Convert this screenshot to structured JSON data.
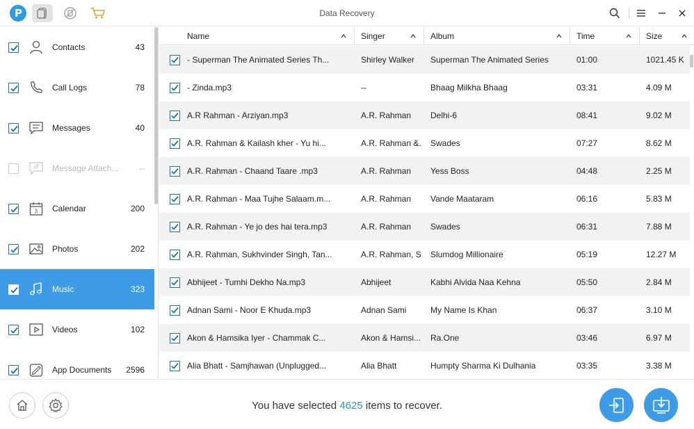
{
  "window": {
    "title": "Data Recovery",
    "logo_letter": "P"
  },
  "sidebar": {
    "items": [
      {
        "label": "Contacts",
        "count": "43",
        "icon": "person-icon",
        "checked": true
      },
      {
        "label": "Call Logs",
        "count": "78",
        "icon": "phone-icon",
        "checked": true
      },
      {
        "label": "Messages",
        "count": "40",
        "icon": "message-icon",
        "checked": true
      },
      {
        "label": "Message Attach...",
        "count": "--",
        "icon": "attachment-icon",
        "checked": false
      },
      {
        "label": "Calendar",
        "count": "200",
        "icon": "calendar-icon",
        "checked": true
      },
      {
        "label": "Photos",
        "count": "202",
        "icon": "photo-icon",
        "checked": true
      },
      {
        "label": "Music",
        "count": "323",
        "icon": "music-icon",
        "checked": true
      },
      {
        "label": "Videos",
        "count": "102",
        "icon": "video-icon",
        "checked": true
      },
      {
        "label": "App Documents",
        "count": "2596",
        "icon": "document-icon",
        "checked": true
      }
    ],
    "calendar_day": "3"
  },
  "table": {
    "columns": [
      "Name",
      "Singer",
      "Album",
      "Time",
      "Size"
    ],
    "rows": [
      {
        "name": "- Superman The Animated Series Th...",
        "singer": "Shirley Walker",
        "album": "Superman The Animated Series",
        "time": "01:00",
        "size": "1021.45 K"
      },
      {
        "name": "- Zinda.mp3",
        "singer": "--",
        "album": "Bhaag Milkha Bhaag",
        "time": "03:31",
        "size": "4.09 M"
      },
      {
        "name": "A.R Rahman - Arziyan.mp3",
        "singer": "A.R. Rahman",
        "album": "Delhi-6",
        "time": "08:41",
        "size": "9.02 M"
      },
      {
        "name": "A.R. Rahman & Kailash kher - Yu hi...",
        "singer": "A.R. Rahman &...",
        "album": "Swades",
        "time": "07:27",
        "size": "8.62 M"
      },
      {
        "name": "A.R. Rahman - Chaand Taare .mp3",
        "singer": "A.R. Rahman",
        "album": "Yess Boss",
        "time": "04:48",
        "size": "2.25 M"
      },
      {
        "name": "A.R. Rahman - Maa Tujhe Salaam.m...",
        "singer": "A.R. Rahman",
        "album": "Vande Maataram",
        "time": "06:16",
        "size": "5.83 M"
      },
      {
        "name": "A.R. Rahman - Ye jo des hai tera.mp3",
        "singer": "A.R. Rahman",
        "album": "Swades",
        "time": "06:31",
        "size": "7.88 M"
      },
      {
        "name": "A.R. Rahman, Sukhvinder Singh, Tan...",
        "singer": "A.R. Rahman, S...",
        "album": "Slumdog Millionaire",
        "time": "05:19",
        "size": "12.27 M"
      },
      {
        "name": "Abhijeet - Tumhi Dekho Na.mp3",
        "singer": "Abhijeet",
        "album": "Kabhi Alvida Naa Kehna",
        "time": "05:50",
        "size": "2.84 M"
      },
      {
        "name": "Adnan Sami - Noor E Khuda.mp3",
        "singer": "Adnan Sami",
        "album": "My Name Is Khan",
        "time": "06:37",
        "size": "3.10 M"
      },
      {
        "name": "Akon & Hamsika Iyer - Chammak C...",
        "singer": "Akon & Hamsi...",
        "album": "Ra.One",
        "time": "03:46",
        "size": "6.97 M"
      },
      {
        "name": "Alia Bhatt - Samjhawan (Unplugged...",
        "singer": "Alia Bhatt",
        "album": "Humpty Sharma Ki Dulhania",
        "time": "03:35",
        "size": "3.38 M"
      }
    ]
  },
  "footer": {
    "status_prefix": "You have selected ",
    "selected_count": "4625",
    "status_suffix": " items to recover."
  },
  "colors": {
    "accent": "#3e9be6",
    "check": "#1f6fa8",
    "cart": "#f0a030"
  }
}
